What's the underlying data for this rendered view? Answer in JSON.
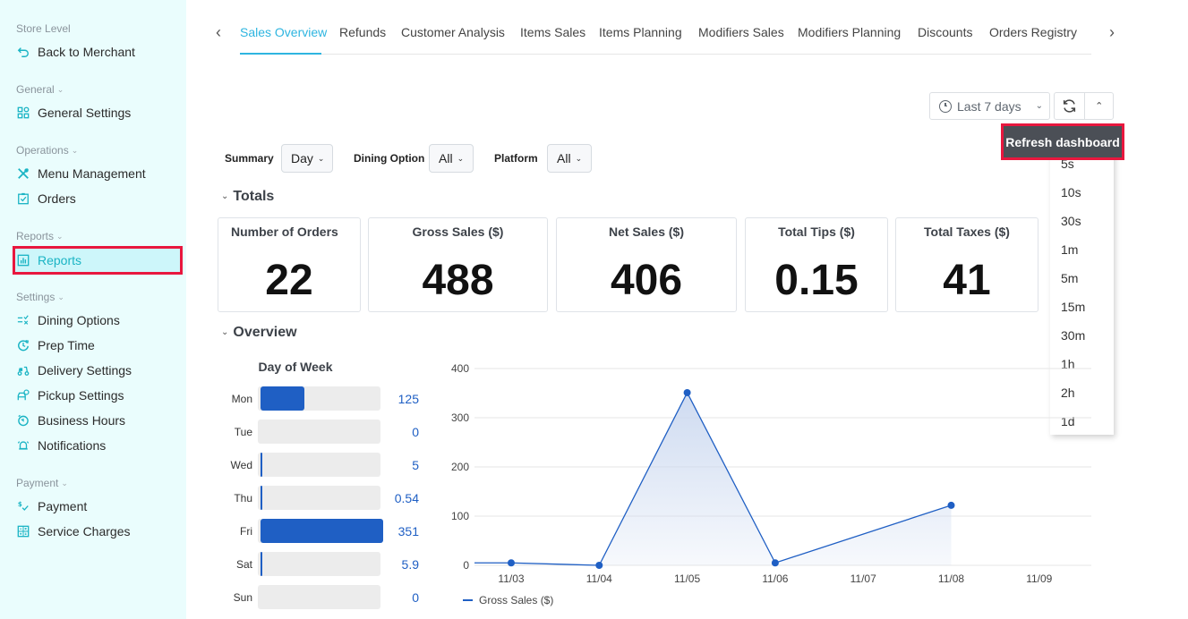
{
  "sidebar": {
    "store_level_label": "Store Level",
    "back_to_merchant": "Back to Merchant",
    "groups": {
      "general": "General",
      "operations": "Operations",
      "reports": "Reports",
      "settings": "Settings",
      "payment": "Payment"
    },
    "items": {
      "general_settings": "General Settings",
      "menu_management": "Menu Management",
      "orders": "Orders",
      "reports": "Reports",
      "dining_options": "Dining Options",
      "prep_time": "Prep Time",
      "delivery_settings": "Delivery Settings",
      "pickup_settings": "Pickup Settings",
      "business_hours": "Business Hours",
      "notifications": "Notifications",
      "payment": "Payment",
      "service_charges": "Service Charges"
    },
    "active_item": "Reports",
    "accent_color": "#1ab4c4"
  },
  "tabs": {
    "items": [
      "Sales Overview",
      "Refunds",
      "Customer Analysis",
      "Items Sales",
      "Items Planning",
      "Modifiers Sales",
      "Modifiers Planning",
      "Discounts",
      "Orders Registry"
    ],
    "active": "Sales Overview",
    "prev_icon": "chevron-left-icon",
    "next_icon": "chevron-right-icon"
  },
  "controls": {
    "date_range": "Last 7 days",
    "refresh_tooltip": "Refresh dashboard",
    "refresh_intervals": [
      "5s",
      "10s",
      "30s",
      "1m",
      "5m",
      "15m",
      "30m",
      "1h",
      "2h",
      "1d"
    ]
  },
  "filters": {
    "summary_label": "Summary",
    "summary_value": "Day",
    "dining_option_label": "Dining Option",
    "dining_option_value": "All",
    "platform_label": "Platform",
    "platform_value": "All"
  },
  "totals": {
    "title": "Totals",
    "cards": [
      {
        "label": "Number of Orders",
        "value": "22"
      },
      {
        "label": "Gross Sales ($)",
        "value": "488"
      },
      {
        "label": "Net Sales ($)",
        "value": "406"
      },
      {
        "label": "Total Tips ($)",
        "value": "0.15"
      },
      {
        "label": "Total Taxes ($)",
        "value": "41"
      }
    ]
  },
  "overview": {
    "title": "Overview",
    "day_of_week": {
      "title": "Day of Week",
      "rows": [
        {
          "day": "Mon",
          "value": 125,
          "display": "125"
        },
        {
          "day": "Tue",
          "value": 0,
          "display": "0"
        },
        {
          "day": "Wed",
          "value": 5,
          "display": "5"
        },
        {
          "day": "Thu",
          "value": 0.54,
          "display": "0.54"
        },
        {
          "day": "Fri",
          "value": 351,
          "display": "351"
        },
        {
          "day": "Sat",
          "value": 5.9,
          "display": "5.9"
        },
        {
          "day": "Sun",
          "value": 0,
          "display": "0"
        }
      ],
      "max": 351,
      "bar_color": "#1f5fc4"
    }
  },
  "chart_data": {
    "type": "area",
    "title": "",
    "xlabel": "",
    "ylabel": "",
    "categories": [
      "11/03",
      "11/04",
      "11/05",
      "11/06",
      "11/07",
      "11/08",
      "11/09"
    ],
    "series": [
      {
        "name": "Gross Sales ($)",
        "values": [
          5,
          0,
          351,
          5,
          null,
          122,
          null
        ],
        "color": "#1f5fc4"
      }
    ],
    "leading_value": 5,
    "yticks": [
      0,
      100,
      200,
      300,
      400
    ],
    "ylim": [
      0,
      400
    ],
    "grid": true,
    "legend": "bottom-left"
  }
}
